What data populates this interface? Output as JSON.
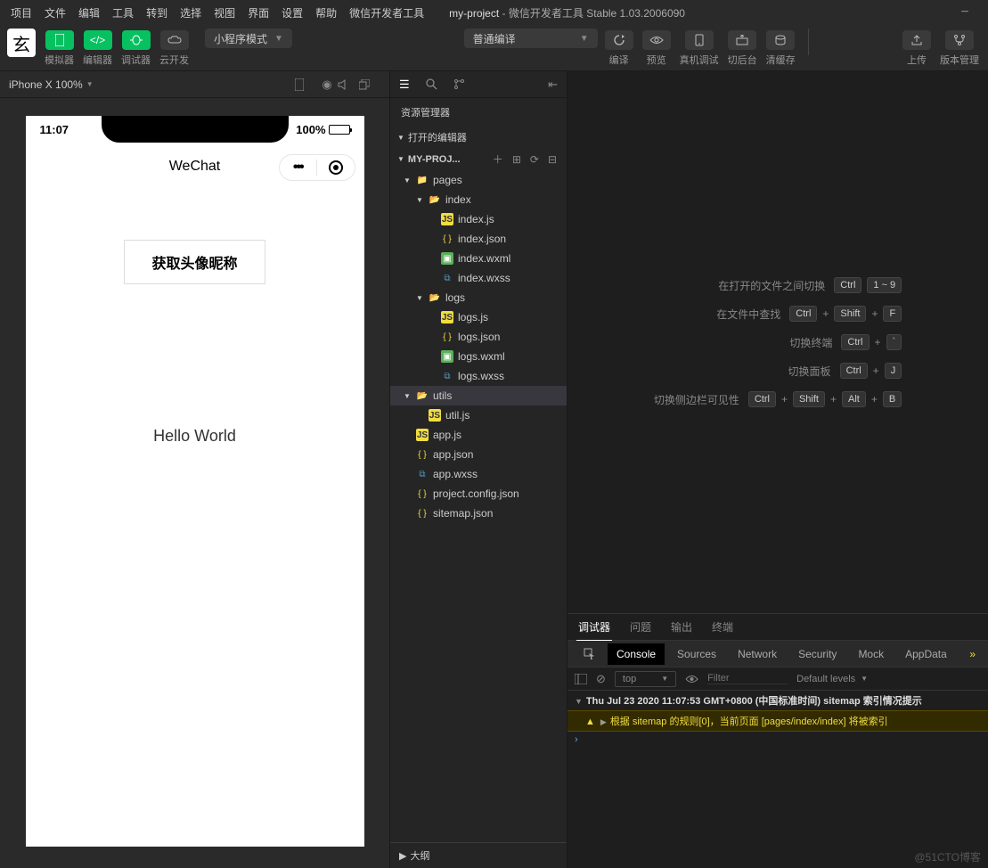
{
  "menubar": {
    "items": [
      "项目",
      "文件",
      "编辑",
      "工具",
      "转到",
      "选择",
      "视图",
      "界面",
      "设置",
      "帮助",
      "微信开发者工具"
    ],
    "projectName": "my-project",
    "appTitle": "- 微信开发者工具 Stable 1.03.2006090"
  },
  "toolbar": {
    "simulator": "模拟器",
    "editor": "编辑器",
    "debugger": "调试器",
    "cloud": "云开发",
    "mode": "小程序模式",
    "compileMode": "普通编译",
    "compile": "编译",
    "preview": "预览",
    "remote": "真机调试",
    "background": "切后台",
    "clearCache": "清缓存",
    "upload": "上传",
    "version": "版本管理"
  },
  "simHeader": {
    "device": "iPhone X 100%"
  },
  "phone": {
    "time": "11:07",
    "battery": "100%",
    "navTitle": "WeChat",
    "avatarBtn": "获取头像昵称",
    "hello": "Hello World"
  },
  "explorer": {
    "title": "资源管理器",
    "openEditors": "打开的编辑器",
    "project": "MY-PROJ...",
    "outline": "大纲",
    "tree": [
      {
        "name": "pages",
        "type": "folder-red",
        "depth": 0,
        "open": true
      },
      {
        "name": "index",
        "type": "folder",
        "depth": 1,
        "open": true
      },
      {
        "name": "index.js",
        "type": "js",
        "depth": 2
      },
      {
        "name": "index.json",
        "type": "json",
        "depth": 2
      },
      {
        "name": "index.wxml",
        "type": "wxml",
        "depth": 2
      },
      {
        "name": "index.wxss",
        "type": "wxss",
        "depth": 2
      },
      {
        "name": "logs",
        "type": "folder-grn",
        "depth": 1,
        "open": true
      },
      {
        "name": "logs.js",
        "type": "js",
        "depth": 2
      },
      {
        "name": "logs.json",
        "type": "json",
        "depth": 2
      },
      {
        "name": "logs.wxml",
        "type": "wxml",
        "depth": 2
      },
      {
        "name": "logs.wxss",
        "type": "wxss",
        "depth": 2
      },
      {
        "name": "utils",
        "type": "folder-grn",
        "depth": 0,
        "open": true,
        "sel": true
      },
      {
        "name": "util.js",
        "type": "js",
        "depth": 1
      },
      {
        "name": "app.js",
        "type": "js",
        "depth": 0
      },
      {
        "name": "app.json",
        "type": "json",
        "depth": 0
      },
      {
        "name": "app.wxss",
        "type": "wxss",
        "depth": 0
      },
      {
        "name": "project.config.json",
        "type": "json",
        "depth": 0
      },
      {
        "name": "sitemap.json",
        "type": "json",
        "depth": 0
      }
    ]
  },
  "shortcuts": [
    {
      "label": "在打开的文件之间切换",
      "keys": [
        "Ctrl",
        "1 ~ 9"
      ]
    },
    {
      "label": "在文件中查找",
      "keys": [
        "Ctrl",
        "+",
        "Shift",
        "+",
        "F"
      ]
    },
    {
      "label": "切换终端",
      "keys": [
        "Ctrl",
        "+",
        "`"
      ]
    },
    {
      "label": "切换面板",
      "keys": [
        "Ctrl",
        "+",
        "J"
      ]
    },
    {
      "label": "切换侧边栏可见性",
      "keys": [
        "Ctrl",
        "+",
        "Shift",
        "+",
        "Alt",
        "+",
        "B"
      ]
    }
  ],
  "panel": {
    "tabs": [
      "调试器",
      "问题",
      "输出",
      "终端"
    ],
    "devtabs": [
      "Console",
      "Sources",
      "Network",
      "Security",
      "Mock",
      "AppData"
    ],
    "context": "top",
    "filterPlaceholder": "Filter",
    "levels": "Default levels",
    "logHeader": "Thu Jul 23 2020 11:07:53 GMT+0800 (中国标准时间) sitemap 索引情况提示",
    "logWarn": "根据 sitemap 的规则[0]，当前页面 [pages/index/index] 将被索引"
  },
  "watermark": "@51CTO博客"
}
